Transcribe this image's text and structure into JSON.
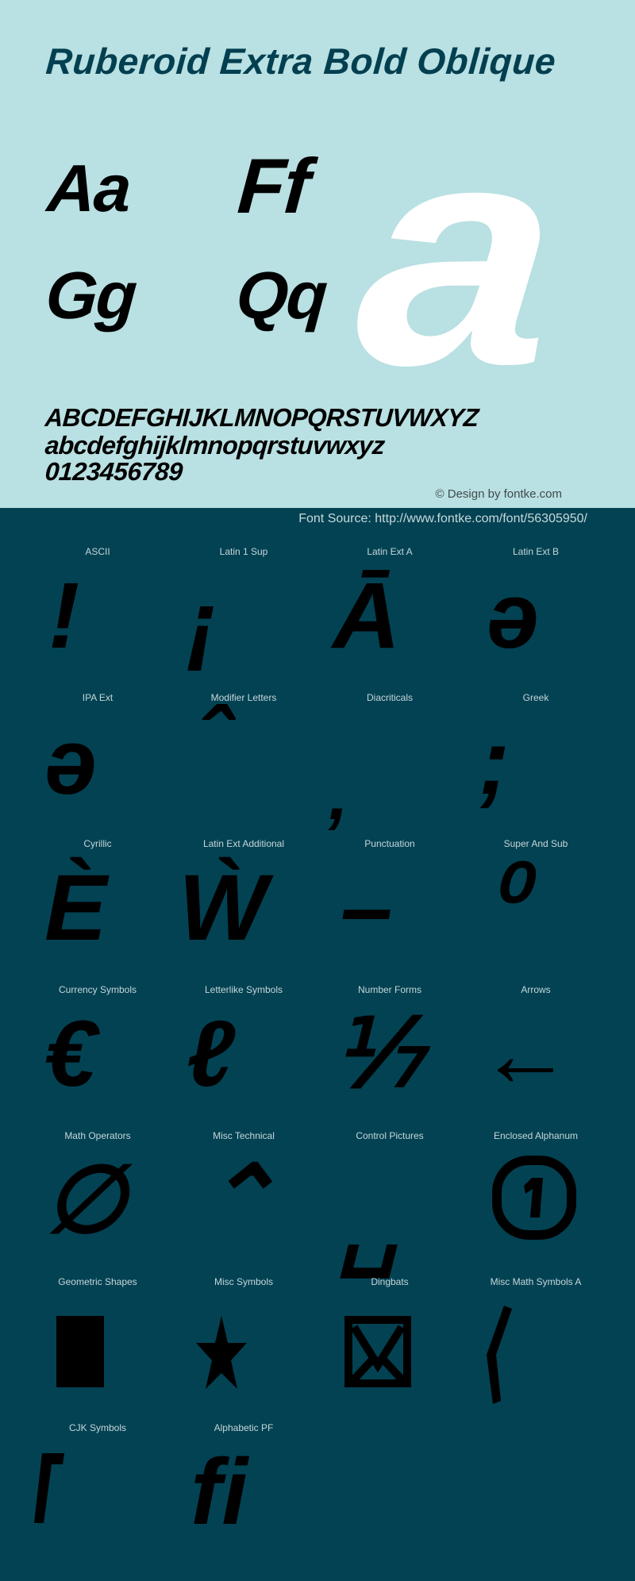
{
  "header": {
    "title": "Ruberoid Extra Bold Oblique"
  },
  "preview": {
    "pairs": [
      "Aa",
      "Ff",
      "Gg",
      "Qq"
    ],
    "big_glyph": "a",
    "uppercase": "ABCDEFGHIJKLMNOPQRSTUVWXYZ",
    "lowercase": "abcdefghijklmnopqrstuvwxyz",
    "digits": "0123456789",
    "credit": "© Design by fontke.com"
  },
  "source": {
    "text": "Font Source: http://www.fontke.com/font/56305950/"
  },
  "colors": {
    "top_background": "#b9e0e2",
    "bottom_background": "#024253",
    "title": "#023f50",
    "big_glyph": "#ffffff",
    "glyph": "#000000",
    "label": "#c7d6d9"
  },
  "blocks": [
    {
      "label": "ASCII",
      "glyph": "!",
      "icon": null
    },
    {
      "label": "Latin 1 Sup",
      "glyph": "¡",
      "icon": null
    },
    {
      "label": "Latin Ext A",
      "glyph": "Ā",
      "icon": null
    },
    {
      "label": "Latin Ext B",
      "glyph": "ə",
      "icon": null
    },
    {
      "label": "IPA Ext",
      "glyph": "ə",
      "icon": null
    },
    {
      "label": "Modifier Letters",
      "glyph": "ˆ",
      "icon": null
    },
    {
      "label": "Diacriticals",
      "glyph": "̦",
      "icon": null
    },
    {
      "label": "Greek",
      "glyph": ";",
      "icon": null
    },
    {
      "label": "Cyrillic",
      "glyph": "È",
      "icon": null
    },
    {
      "label": "Latin Ext Additional",
      "glyph": "Ẁ",
      "icon": null
    },
    {
      "label": "Punctuation",
      "glyph": "–",
      "icon": null
    },
    {
      "label": "Super And Sub",
      "glyph": "⁰",
      "icon": null
    },
    {
      "label": "Currency Symbols",
      "glyph": "€",
      "icon": null
    },
    {
      "label": "Letterlike Symbols",
      "glyph": "ℓ",
      "icon": null
    },
    {
      "label": "Number Forms",
      "glyph": "⅐",
      "icon": null
    },
    {
      "label": "Arrows",
      "glyph": "←",
      "icon": null
    },
    {
      "label": "Math Operators",
      "glyph": "∅",
      "icon": null
    },
    {
      "label": "Misc Technical",
      "glyph": "⌃",
      "icon": null
    },
    {
      "label": "Control Pictures",
      "glyph": "␣",
      "icon": null
    },
    {
      "label": "Enclosed Alphanum",
      "glyph": "⓵",
      "icon": "circled-one"
    },
    {
      "label": "Geometric Shapes",
      "glyph": "■",
      "icon": "black-square"
    },
    {
      "label": "Misc Symbols",
      "glyph": "★",
      "icon": "black-star"
    },
    {
      "label": "Dingbats",
      "glyph": "✉",
      "icon": "envelope"
    },
    {
      "label": "Misc Math Symbols A",
      "glyph": "⟨",
      "icon": "angle-bracket"
    },
    {
      "label": "CJK Symbols",
      "glyph": "「",
      "icon": "corner-bracket"
    },
    {
      "label": "Alphabetic PF",
      "glyph": "ﬁ",
      "icon": null
    }
  ]
}
